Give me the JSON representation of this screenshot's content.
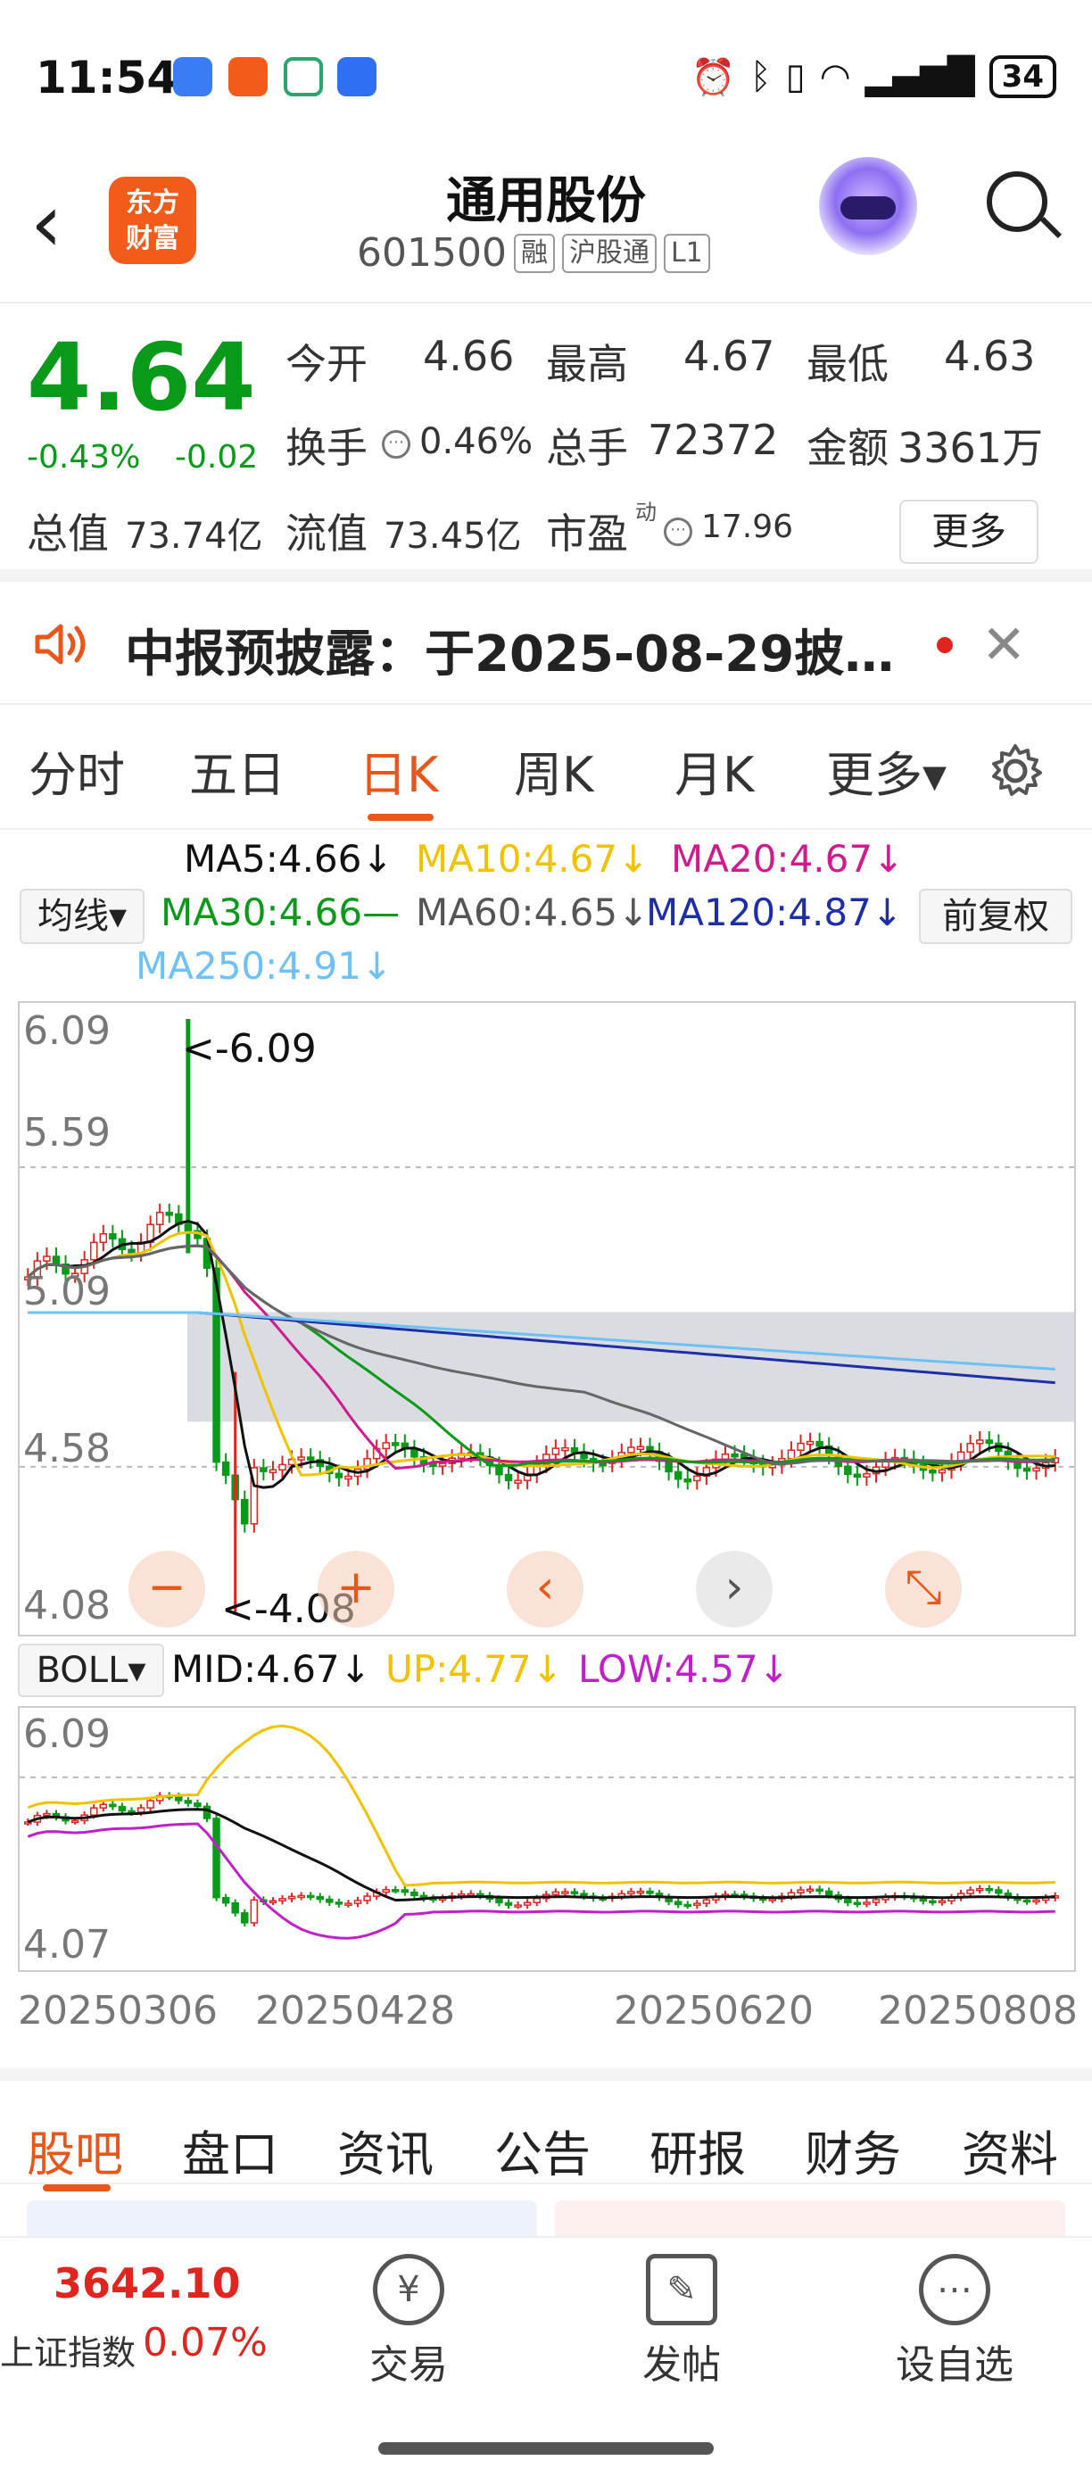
{
  "status_bar": {
    "time": "11:54",
    "battery": "34"
  },
  "header": {
    "title": "通用股份",
    "code": "601500",
    "tags": [
      "融",
      "沪股通",
      "L1"
    ],
    "logo_text": "东方财富"
  },
  "quote": {
    "price": "4.64",
    "change_pct": "-0.43%",
    "change": "-0.02",
    "open_label": "今开",
    "open": "4.66",
    "high_label": "最高",
    "high": "4.67",
    "low_label": "最低",
    "low": "4.63",
    "turnover_label": "换手",
    "turnover": "0.46%",
    "volume_label": "总手",
    "volume": "72372",
    "amount_label": "金额",
    "amount": "3361万",
    "mktcap_label": "总值",
    "mktcap": "73.74亿",
    "float_label": "流值",
    "float": "73.45亿",
    "pe_label": "市盈",
    "pe_sup": "动",
    "pe": "17.96",
    "more": "更多"
  },
  "announcement": {
    "text": "中报预披露：于2025-08-29披…"
  },
  "period_tabs": [
    "分时",
    "五日",
    "日K",
    "周K",
    "月K",
    "更多▾"
  ],
  "period_tabs_active": 2,
  "ma_legend": {
    "ma5": "MA5:4.66↓",
    "ma10": "MA10:4.67↓",
    "ma20": "MA20:4.67↓",
    "ma30": "MA30:4.66—",
    "ma60": "MA60:4.65↓",
    "ma120": "MA120:4.87↓",
    "ma250": "MA250:4.91↓",
    "selector": "均线▾",
    "adjust": "前复权"
  },
  "kline": {
    "y_labels": [
      "6.09",
      "5.59",
      "5.09",
      "4.58",
      "4.08"
    ],
    "max_marker": "<-6.09",
    "min_marker": "<-4.08"
  },
  "boll": {
    "selector": "BOLL▾",
    "mid": "MID:4.67↓",
    "up": "UP:4.77↓",
    "low": "LOW:4.57↓",
    "y_top": "6.09",
    "y_bottom": "4.07"
  },
  "x_dates": [
    "20250306",
    "20250428",
    "20250620",
    "20250808"
  ],
  "bottom_tabs": [
    "股吧",
    "盘口",
    "资讯",
    "公告",
    "研报",
    "财务",
    "资料"
  ],
  "bottom_tabs_active": 0,
  "footer": {
    "index_value": "3642.10",
    "index_name": "上证指数",
    "index_change": "0.07%",
    "trade": "交易",
    "post": "发帖",
    "watch": "设自选"
  },
  "colors": {
    "ma5": "#111111",
    "ma10": "#f2c200",
    "ma20": "#d11a8e",
    "ma30": "#0a9a1a",
    "ma60": "#666666",
    "ma120": "#1c2fa8",
    "ma250": "#6ec1f5",
    "up": "#e0251f",
    "down": "#0a9a1a",
    "accent": "#e8561a"
  },
  "chart_data": {
    "type": "line",
    "title": "",
    "y_range": [
      4.08,
      6.09
    ],
    "x_ticks": [
      "20250306",
      "20250428",
      "20250620",
      "20250808"
    ],
    "series": [
      {
        "name": "MA5",
        "last": 4.66
      },
      {
        "name": "MA10",
        "last": 4.67
      },
      {
        "name": "MA20",
        "last": 4.67
      },
      {
        "name": "MA30",
        "last": 4.66
      },
      {
        "name": "MA60",
        "last": 4.65
      },
      {
        "name": "MA120",
        "last": 4.87
      },
      {
        "name": "MA250",
        "last": 4.91
      }
    ]
  }
}
